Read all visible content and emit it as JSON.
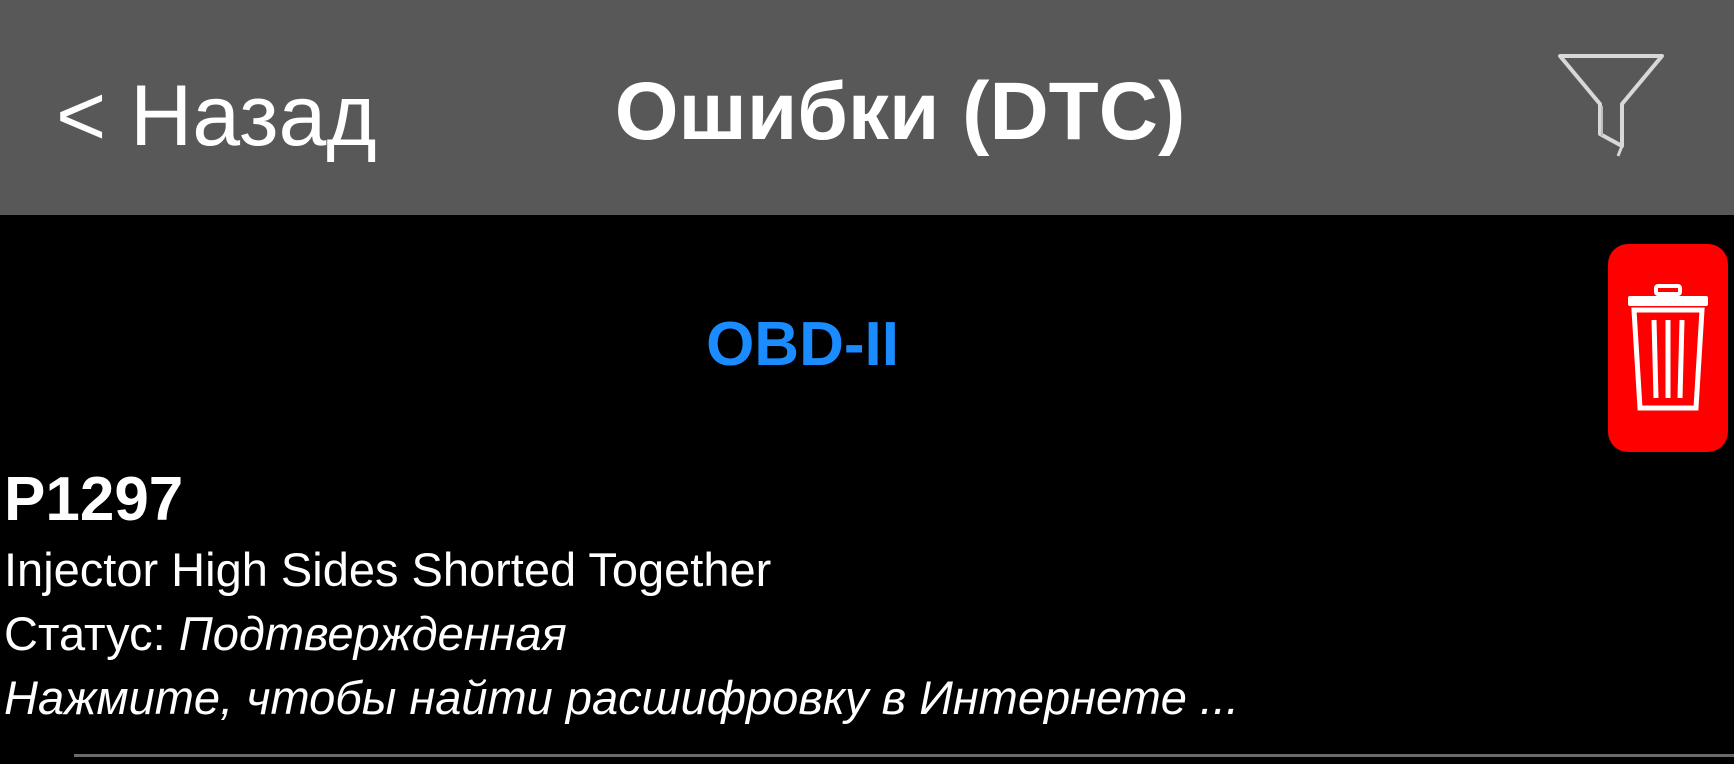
{
  "navbar": {
    "back_label": "< Назад",
    "title": "Ошибки (DTC)",
    "filter_icon": "filter-icon"
  },
  "section": {
    "header": "OBD-II",
    "header_color": "#1a8cff"
  },
  "delete": {
    "icon": "trash-icon",
    "color": "#ff0000"
  },
  "dtc": {
    "code": "P1297",
    "description": "Injector High Sides Shorted Together",
    "status_label": "Статус:",
    "status_value": "Подтвержденная",
    "search_hint": "Нажмите, чтобы найти расшифровку в Интернете ..."
  },
  "colors": {
    "navbar_bg": "#585858",
    "background": "#000000",
    "text": "#ffffff"
  }
}
